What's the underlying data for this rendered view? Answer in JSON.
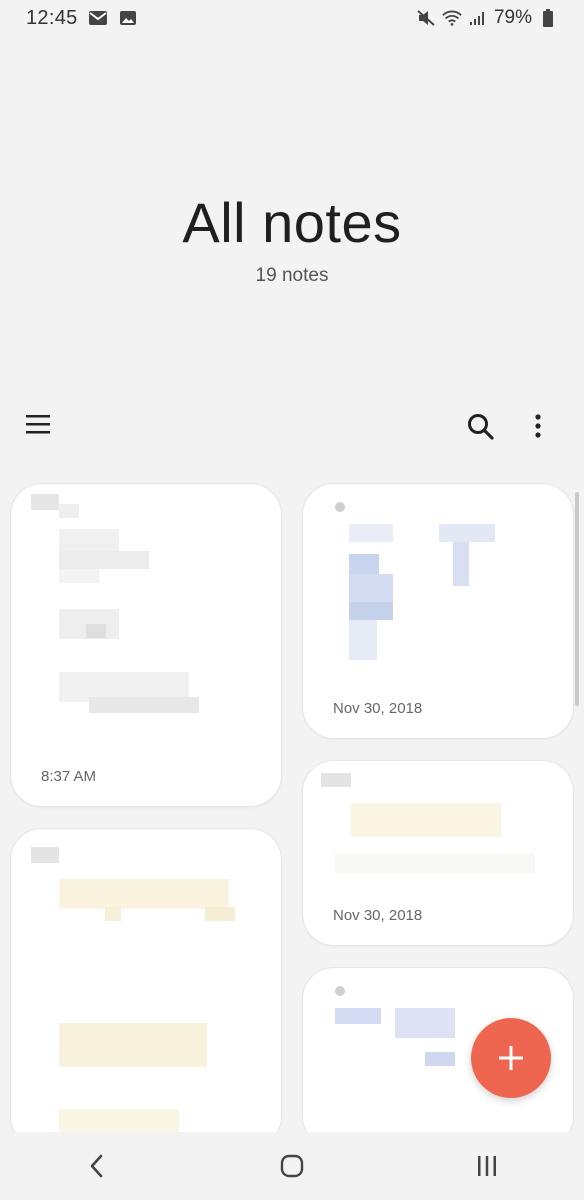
{
  "status_bar": {
    "time": "12:45",
    "battery": "79%",
    "icons": [
      "mail-icon",
      "image-icon",
      "mute-icon",
      "wifi-icon",
      "signal-icon",
      "battery-icon"
    ]
  },
  "header": {
    "title": "All notes",
    "subtitle": "19 notes"
  },
  "toolbar": {
    "icons": [
      "menu-icon",
      "search-icon",
      "more-options-icon"
    ]
  },
  "notes": [
    {
      "date": "8:37 AM"
    },
    {
      "date": "Nov 30, 2018"
    },
    {
      "date": "Nov 30, 2018"
    },
    {
      "date": ""
    },
    {
      "date": ""
    }
  ],
  "fab": {
    "icon": "plus-icon",
    "color": "#ee6650"
  },
  "nav_bar": {
    "icons": [
      "back-icon",
      "home-icon",
      "recent-apps-icon"
    ]
  }
}
